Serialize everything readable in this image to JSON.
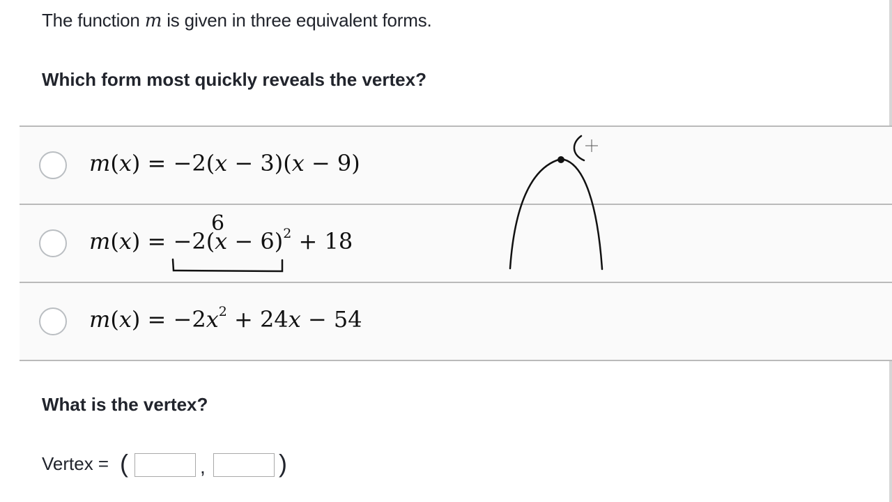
{
  "prompt": {
    "intro_before": "The function ",
    "intro_var": "m",
    "intro_after": " is given in three equivalent forms.",
    "question": "Which form most quickly reveals the vertex?"
  },
  "choices": [
    {
      "lhs": "m(x)",
      "rhs": "= −2(x − 3)(x − 9)"
    },
    {
      "lhs": "m(x)",
      "rhs": "= −2(x − 6)² + 18"
    },
    {
      "lhs": "m(x)",
      "rhs": "= −2x² + 24x − 54"
    }
  ],
  "annotations": {
    "digit": "6"
  },
  "vertex_section": {
    "question": "What is the vertex?",
    "label": "Vertex =",
    "open_paren": "(",
    "comma": ",",
    "close_paren": ")",
    "x_value": "",
    "y_value": ""
  },
  "colors": {
    "text": "#21242c",
    "choice_bg": "#fafafa",
    "divider": "#bababa",
    "radio_border": "#babec2"
  }
}
